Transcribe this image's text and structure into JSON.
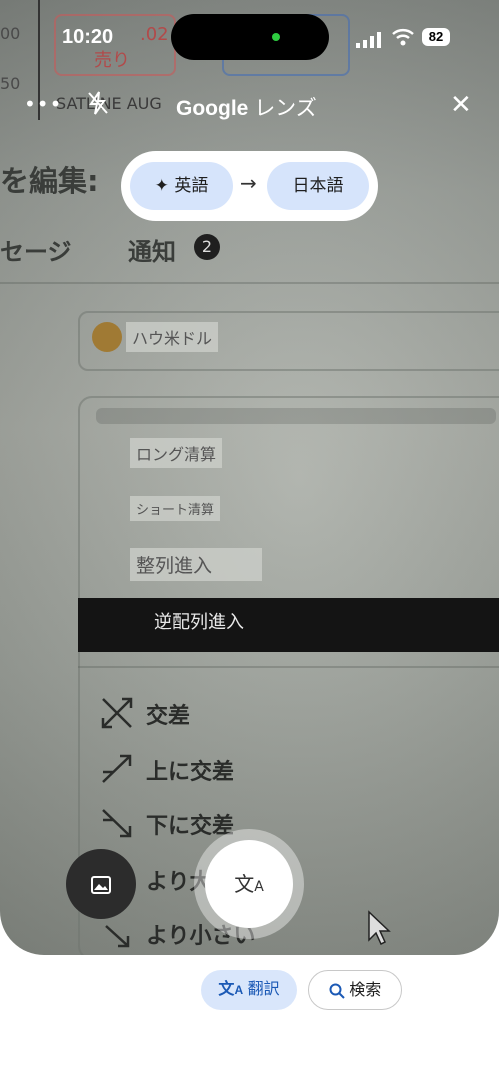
{
  "status_bar": {
    "time": "10:20",
    "battery": "82"
  },
  "top_bar": {
    "title_brand": "Google",
    "title_suffix": "レンズ"
  },
  "language": {
    "source": "英語",
    "arrow": "→",
    "target": "日本語"
  },
  "photo": {
    "bg_numbers": {
      "n1": "00",
      "n2": "50",
      "price": ".02",
      "sell": "売り",
      "satline": "SATLINE AUG"
    },
    "heading": "を編集: ",
    "tabs_text": "セージ",
    "notice_label": "通知",
    "notice_count": "2",
    "field_overlay": "ハウ米ドル",
    "menu_overlays": [
      "ロング清算",
      "ショート清算",
      "整列進入",
      "逆配列進入"
    ],
    "list_items": [
      "交差",
      "上に交差",
      "下に交差",
      "より大",
      "より小さい"
    ]
  },
  "tabs": {
    "translate": "翻訳",
    "search": "検索"
  },
  "icons": {
    "more": "more-icon",
    "flash": "flash-off-icon",
    "close": "close-icon",
    "sparkle": "sparkle-icon",
    "gallery": "gallery-icon",
    "translate": "translate-icon",
    "search": "search-icon"
  }
}
